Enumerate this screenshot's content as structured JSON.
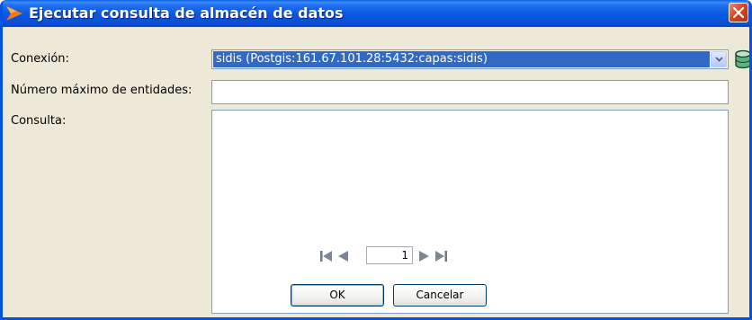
{
  "window": {
    "title": "Ejecutar consulta de almacén de datos"
  },
  "form": {
    "connection_label": "Conexión:",
    "connection_value": "sidis  (Postgis:161.67.101.28:5432:capas:sidis)",
    "max_entities_label": "Número máximo de entidades:",
    "max_entities_value": "",
    "query_label": "Consulta:",
    "query_value": ""
  },
  "pager": {
    "current_page": "1"
  },
  "buttons": {
    "ok_label": "OK",
    "cancel_label": "Cancelar"
  },
  "colors": {
    "titlebar": "#0a56e0",
    "selection": "#316ac5",
    "dialog_bg": "#ece9d8",
    "close_button": "#d4411c"
  }
}
